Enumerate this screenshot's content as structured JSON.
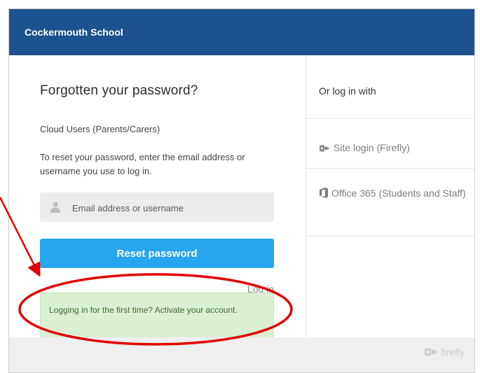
{
  "header": {
    "school_name": "Cockermouth School"
  },
  "form": {
    "title": "Forgotten your password?",
    "subtitle": "Cloud Users (Parents/Carers)",
    "description": "To reset your password, enter the email address or username you use to log in.",
    "email_placeholder": "Email address or username",
    "email_value": "",
    "reset_button": "Reset password",
    "login_link": "Log in",
    "activate_notice": "Logging in for the first time? Activate your account."
  },
  "alt_login": {
    "heading": "Or log in with",
    "options": [
      {
        "label": "Site login (Firefly)",
        "icon": "firefly-icon"
      },
      {
        "label": "Office 365 (Students and Staff)",
        "icon": "office-icon"
      }
    ]
  },
  "footer": {
    "brand": "firefly",
    "icon": "firefly-logo-icon"
  },
  "colors": {
    "header_bg": "#1d518f",
    "button_bg": "#27a5ef",
    "notice_bg": "#dbefd3",
    "annotation_red": "#e00000"
  },
  "annotations": {
    "icon": "red-arrow-and-ellipse"
  }
}
